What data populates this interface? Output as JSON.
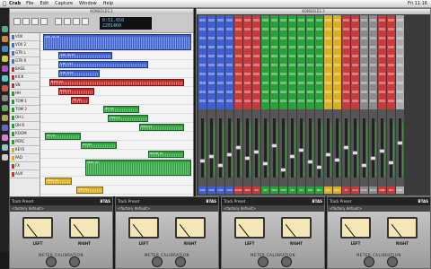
{
  "menubar": {
    "app": "Crab",
    "items": [
      "File",
      "Edit",
      "Capture",
      "Window",
      "Help"
    ],
    "clock": "Fri 11:16"
  },
  "edit_window": {
    "title": "KONSOLES 2",
    "counter_main": "0:51.650",
    "counter_sub": "2201460",
    "tracks": [
      {
        "label": "VOX",
        "color": "#4a6fd0"
      },
      {
        "label": "VOX 2",
        "color": "#4a6fd0"
      },
      {
        "label": "GTR L",
        "color": "#4a6fd0"
      },
      {
        "label": "GTR R",
        "color": "#4a6fd0"
      },
      {
        "label": "BASS",
        "color": "#c03030"
      },
      {
        "label": "KICK",
        "color": "#c03030"
      },
      {
        "label": "SN",
        "color": "#c03030"
      },
      {
        "label": "HH",
        "color": "#2a9a3a"
      },
      {
        "label": "TOM 1",
        "color": "#2a9a3a"
      },
      {
        "label": "TOM 2",
        "color": "#2a9a3a"
      },
      {
        "label": "OH L",
        "color": "#2a9a3a"
      },
      {
        "label": "OH R",
        "color": "#2a9a3a"
      },
      {
        "label": "ROOM",
        "color": "#2a9a3a"
      },
      {
        "label": "PERC",
        "color": "#2a9a3a"
      },
      {
        "label": "KEYS",
        "color": "#d8b020"
      },
      {
        "label": "PAD",
        "color": "#d8b020"
      },
      {
        "label": "FX",
        "color": "#c03030"
      },
      {
        "label": "AUX",
        "color": "#c03030"
      }
    ],
    "clips": [
      {
        "label": "VOX_01-04",
        "color": "#3a5fcf"
      },
      {
        "label": "VOX_02-07",
        "color": "#3a5fcf"
      },
      {
        "label": "GTR_L-03",
        "color": "#3a5fcf"
      },
      {
        "label": "GTR_R-03",
        "color": "#3a5fcf"
      },
      {
        "label": "BASS_01",
        "color": "#c02828"
      },
      {
        "label": "KICK_01",
        "color": "#c02828"
      },
      {
        "label": "SN_01",
        "color": "#c02828"
      },
      {
        "label": "HH_02",
        "color": "#2aa03a"
      },
      {
        "label": "TOM_01",
        "color": "#2aa03a"
      },
      {
        "label": "TOM_02",
        "color": "#2aa03a"
      },
      {
        "label": "OH_01",
        "color": "#2aa03a"
      },
      {
        "label": "OH_02",
        "color": "#2aa03a"
      },
      {
        "label": "ROOM_01",
        "color": "#2aa03a"
      },
      {
        "label": "PERC_01",
        "color": "#2aa03a"
      },
      {
        "label": "KEYS_01",
        "color": "#d8b020"
      },
      {
        "label": "PAD_01",
        "color": "#d8b020"
      }
    ]
  },
  "mix_window": {
    "title": "KONSOLES 2",
    "strips": [
      {
        "name": "VOX",
        "color": "#3f5fcf"
      },
      {
        "name": "VOX",
        "color": "#3f5fcf"
      },
      {
        "name": "GTR",
        "color": "#3f5fcf"
      },
      {
        "name": "GTR",
        "color": "#3f5fcf"
      },
      {
        "name": "BASS",
        "color": "#c53a3a"
      },
      {
        "name": "KCK",
        "color": "#c53a3a"
      },
      {
        "name": "SN",
        "color": "#c53a3a"
      },
      {
        "name": "HH",
        "color": "#2aa03a"
      },
      {
        "name": "TOM",
        "color": "#2aa03a"
      },
      {
        "name": "TOM",
        "color": "#2aa03a"
      },
      {
        "name": "OH",
        "color": "#2aa03a"
      },
      {
        "name": "OH",
        "color": "#2aa03a"
      },
      {
        "name": "RM",
        "color": "#2aa03a"
      },
      {
        "name": "PRC",
        "color": "#2aa03a"
      },
      {
        "name": "KEY",
        "color": "#d8b020"
      },
      {
        "name": "PAD",
        "color": "#d8b020"
      },
      {
        "name": "FX",
        "color": "#c53a3a"
      },
      {
        "name": "AUX",
        "color": "#c53a3a"
      },
      {
        "name": "BUS",
        "color": "#8a8a8a"
      },
      {
        "name": "BUS",
        "color": "#8a8a8a"
      },
      {
        "name": "VRB",
        "color": "#c53a3a"
      },
      {
        "name": "DLY",
        "color": "#c53a3a"
      },
      {
        "name": "MST",
        "color": "#aaaaaa"
      }
    ]
  },
  "plugins": [
    {
      "header": "Track Preset",
      "brand": "BTAS",
      "preset": "<factory default>",
      "left": "LEFT",
      "right": "RIGHT",
      "calibration": "METER CALIBRATION"
    },
    {
      "header": "Track Preset",
      "brand": "BTAS",
      "preset": "<factory default>",
      "left": "LEFT",
      "right": "RIGHT",
      "calibration": "METER CALIBRATION"
    },
    {
      "header": "Track Preset",
      "brand": "BTAS",
      "preset": "<factory default>",
      "left": "LEFT",
      "right": "RIGHT",
      "calibration": "METER CALIBRATION"
    },
    {
      "header": "Track Preset",
      "brand": "BTAS",
      "preset": "<factory default>",
      "left": "LEFT",
      "right": "RIGHT",
      "calibration": "METER CALIBRATION"
    }
  ],
  "colors": {
    "blue": "#3f5fcf",
    "red": "#c53a3a",
    "green": "#2aa03a",
    "yellow": "#d8b020"
  }
}
